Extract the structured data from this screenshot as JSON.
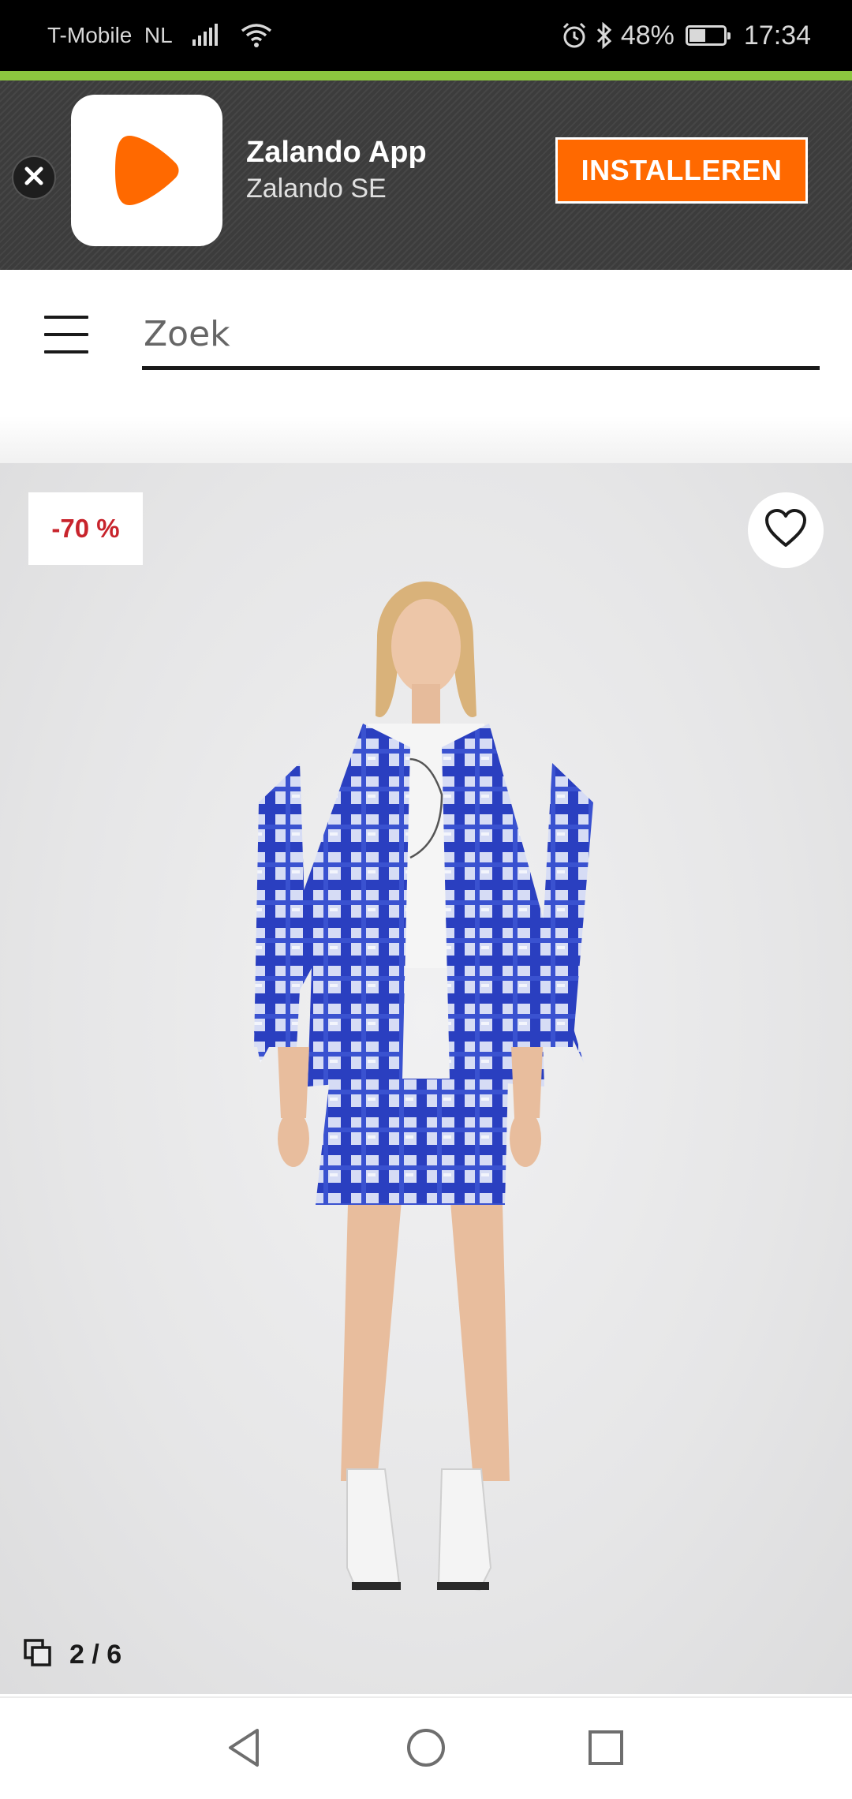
{
  "status_bar": {
    "carrier": "T-Mobile  NL",
    "battery_percent": "48%",
    "battery_level": 0.48,
    "time": "17:34",
    "icons": [
      "signal-icon",
      "wifi-icon",
      "alarm-icon",
      "bluetooth-icon",
      "battery-icon"
    ]
  },
  "app_banner": {
    "app_name": "Zalando App",
    "publisher": "Zalando SE",
    "install_label": "INSTALLEREN",
    "close_icon": "close-icon",
    "colors": {
      "brand_orange": "#ff6900",
      "banner_bg": "#3c3c3c",
      "accent_green": "#8cc63f"
    }
  },
  "header": {
    "menu_icon": "hamburger-menu-icon",
    "search_placeholder": "Zoek"
  },
  "product": {
    "discount_label": "-70 %",
    "discount_color": "#c8242c",
    "wishlist_icon": "heart-icon",
    "gallery_icon": "gallery-icon",
    "gallery_position": "2 / 6",
    "garment_color": "#2a3fc0"
  },
  "nav_bar": {
    "back_icon": "back-triangle-icon",
    "home_icon": "home-circle-icon",
    "recents_icon": "recents-square-icon"
  }
}
